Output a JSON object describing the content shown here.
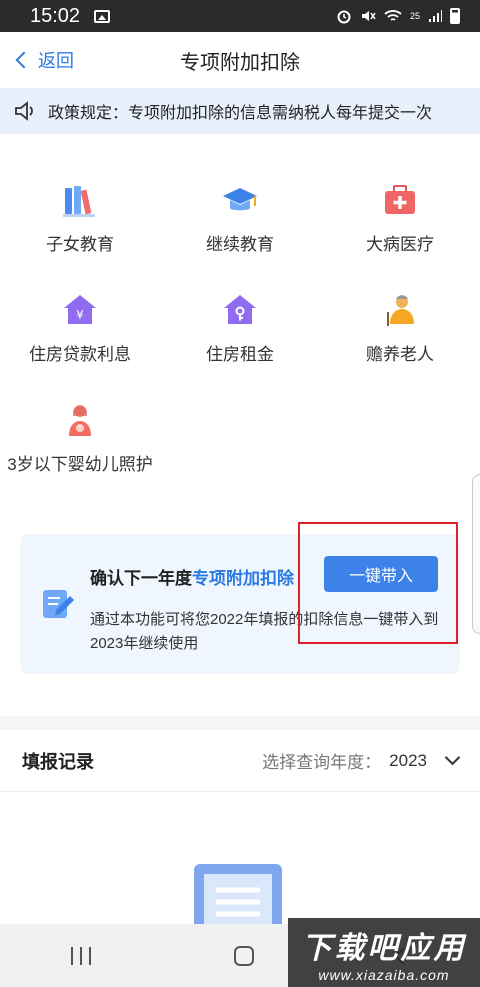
{
  "status_bar": {
    "time": "15:02",
    "network": "25"
  },
  "header": {
    "back_label": "返回",
    "title": "专项附加扣除"
  },
  "notice": {
    "text": "政策规定：专项附加扣除的信息需纳税人每年提交一次"
  },
  "categories": [
    {
      "label": "子女教育",
      "icon": "books-icon"
    },
    {
      "label": "继续教育",
      "icon": "graduation-cap-icon"
    },
    {
      "label": "大病医疗",
      "icon": "medical-kit-icon"
    },
    {
      "label": "住房贷款利息",
      "icon": "house-loan-icon"
    },
    {
      "label": "住房租金",
      "icon": "house-key-icon"
    },
    {
      "label": "赡养老人",
      "icon": "elder-icon"
    },
    {
      "label": "3岁以下婴幼儿照护",
      "icon": "mother-baby-icon"
    }
  ],
  "promo": {
    "title_prefix": "确认下一年度",
    "title_highlight": "专项附加扣除",
    "description": "通过本功能可将您2022年填报的扣除信息一键带入到2023年继续使用",
    "button_label": "一键带入"
  },
  "records": {
    "title": "填报记录",
    "year_label": "选择查询年度：",
    "year_value": "2023"
  },
  "watermark": {
    "line1": "下载吧应用",
    "line2": "www.xiazaiba.com"
  },
  "colors": {
    "accent": "#2a7ae2",
    "notice_bg": "#e8f1fb",
    "highlight_box": "#e0202a"
  }
}
